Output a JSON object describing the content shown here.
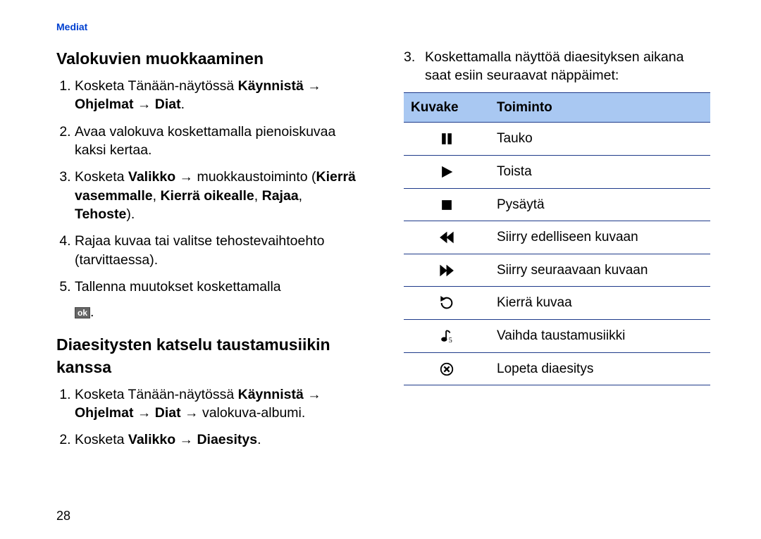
{
  "section_tag": "Mediat",
  "page_number": "28",
  "left": {
    "h1": "Valokuvien muokkaaminen",
    "steps1": [
      {
        "pre": "Kosketa Tänään-näytössä ",
        "bold": "Käynnistä → Ohjelmat → Diat",
        "post": "."
      },
      {
        "pre": "Avaa valokuva koskettamalla pienoiskuvaa kaksi kertaa.",
        "bold": "",
        "post": ""
      },
      {
        "pre": "Kosketa ",
        "bold": "Valikko",
        "post": " → muokkaus­toiminto (",
        "bold2": "Kierrä vasemmalle",
        "post2": ", ",
        "bold3": "Kierrä oikealle",
        "post3": ", ",
        "bold4": "Rajaa",
        "post4": ", ",
        "bold5": "Tehoste",
        "post5": ")."
      },
      {
        "pre": "Rajaa kuvaa tai valitse tehostevaihtoehto (tarvittaessa).",
        "bold": "",
        "post": ""
      },
      {
        "pre": "Tallenna muutokset koskettamalla",
        "bold": "",
        "post": ""
      }
    ],
    "ok_text": "ok",
    "ok_trail": ".",
    "h2": "Diaesitysten katselu taustamusiikin kanssa",
    "steps2": [
      {
        "pre": "Kosketa Tänään-näytössä ",
        "bold": "Käynnistä → Ohjelmat → Diat",
        "post": " → valokuva-albumi."
      },
      {
        "pre": "Kosketa ",
        "bold": "Valikko → Diaesitys",
        "post": "."
      }
    ]
  },
  "right": {
    "intro_num": "3.",
    "intro": "Koskettamalla näyttöä diaesityksen aikana saat esiin seuraavat näppäimet:",
    "table": {
      "col1": "Kuvake",
      "col2": "Toiminto",
      "rows": [
        {
          "icon": "pause",
          "label": "Tauko"
        },
        {
          "icon": "play",
          "label": "Toista"
        },
        {
          "icon": "stop",
          "label": "Pysäytä"
        },
        {
          "icon": "rewind",
          "label": "Siirry edelliseen kuvaan"
        },
        {
          "icon": "fastfwd",
          "label": "Siirry seuraavaan kuvaan"
        },
        {
          "icon": "rotate",
          "label": "Kierrä kuvaa"
        },
        {
          "icon": "music",
          "label": "Vaihda taustamusiikki"
        },
        {
          "icon": "close",
          "label": "Lopeta diaesitys"
        }
      ]
    }
  }
}
